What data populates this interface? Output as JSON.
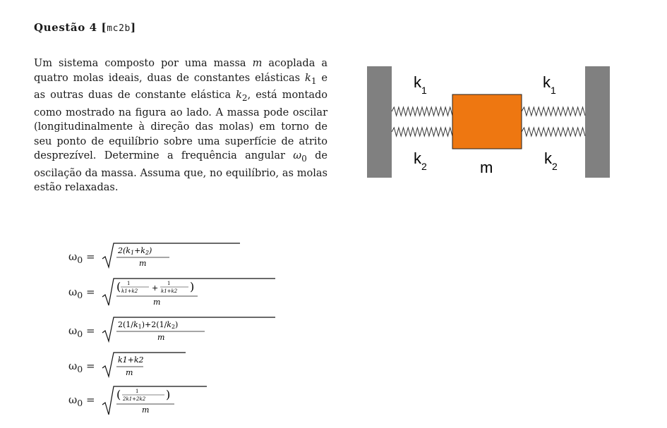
{
  "question": {
    "title": "Questão 4",
    "code": "mc2b"
  },
  "body_text": {
    "before_m": "Um sistema composto por uma massa ",
    "m": "m",
    "after_m": " acoplada a quatro molas ideais, duas de constantes elásticas ",
    "k1": "k",
    "sub1": "1",
    "mid": " e as outras duas de constante elástica ",
    "k2": "k",
    "sub2": "2",
    "rest": ", está montado como mostrado na figura ao lado. A massa pode oscilar (longitudinalmente à direção das molas) em torno de seu ponto de equilíbrio sobre uma superfície de atrito desprezível. Determine a frequência angular ",
    "omega": "ω",
    "sub0": "0",
    "end": " de oscilação da massa. Assuma que, no equilíbrio, as molas estão relaxadas."
  },
  "options": [
    {
      "lhs": "ω0 =",
      "numerator": "2(k1+k2)",
      "denominator": "m"
    },
    {
      "lhs": "ω0 =",
      "numerator": "(1/(k1+k2) + 1/(k1+k2))",
      "denominator": "m"
    },
    {
      "lhs": "ω0 =",
      "numerator": "2(1/k1)+2(1/k2)",
      "denominator": "m"
    },
    {
      "lhs": "ω0 =",
      "numerator": "k1+k2",
      "denominator": "m"
    },
    {
      "lhs": "ω0 =",
      "numerator": "(1/(2k1+2k2))",
      "denominator": "m"
    }
  ],
  "figure": {
    "labels": {
      "k1_left": "k",
      "k1_left_sub": "1",
      "k1_right": "k",
      "k1_right_sub": "1",
      "k2_left": "k",
      "k2_left_sub": "2",
      "k2_right": "k",
      "k2_right_sub": "2",
      "mass": "m"
    },
    "colors": {
      "wall": "#808080",
      "mass": "#ee7711",
      "spring": "#333333"
    }
  }
}
